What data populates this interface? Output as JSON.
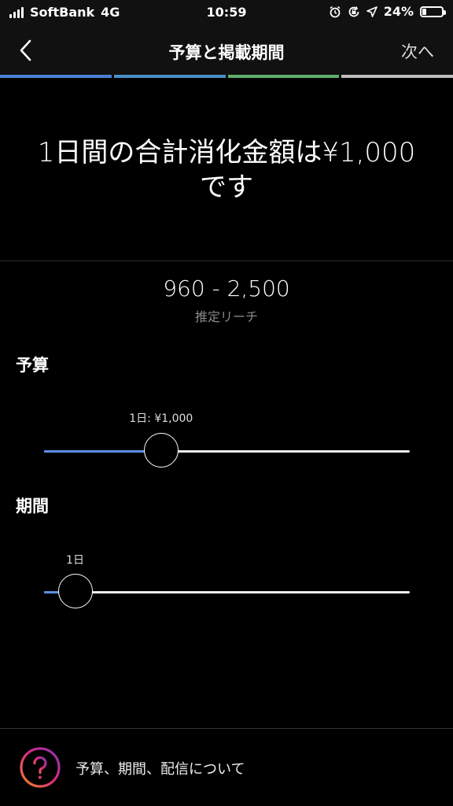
{
  "status_bar": {
    "carrier": "SoftBank",
    "network": "4G",
    "time": "10:59",
    "battery_percent": "24%",
    "battery_level": 0.24,
    "icons": [
      "signal-icon",
      "alarm-icon",
      "screen-rotation-lock-icon",
      "location-icon",
      "battery-icon"
    ]
  },
  "nav": {
    "back_icon": "chevron-left-icon",
    "title": "予算と掲載期間",
    "next_label": "次へ"
  },
  "progress_steps": [
    {
      "color": "#4a80d6"
    },
    {
      "color": "#4a90c8"
    },
    {
      "color": "#5fae6e"
    },
    {
      "color": "#bdbdbd"
    }
  ],
  "summary": {
    "headline_line1": "1日間の合計消化金額は¥1,000",
    "headline_line2": "です"
  },
  "reach": {
    "value": "960 - 2,500",
    "label": "推定リーチ"
  },
  "budget": {
    "title": "予算",
    "slider_label": "1日: ¥1,000",
    "slider_fraction": 0.32
  },
  "duration": {
    "title": "期間",
    "slider_label": "1日",
    "slider_fraction": 0.085
  },
  "help": {
    "icon": "question-mark-icon",
    "text": "予算、期間、配信について"
  },
  "colors": {
    "accent": "#5b8fe6",
    "background": "#000000",
    "bar": "#111111"
  }
}
